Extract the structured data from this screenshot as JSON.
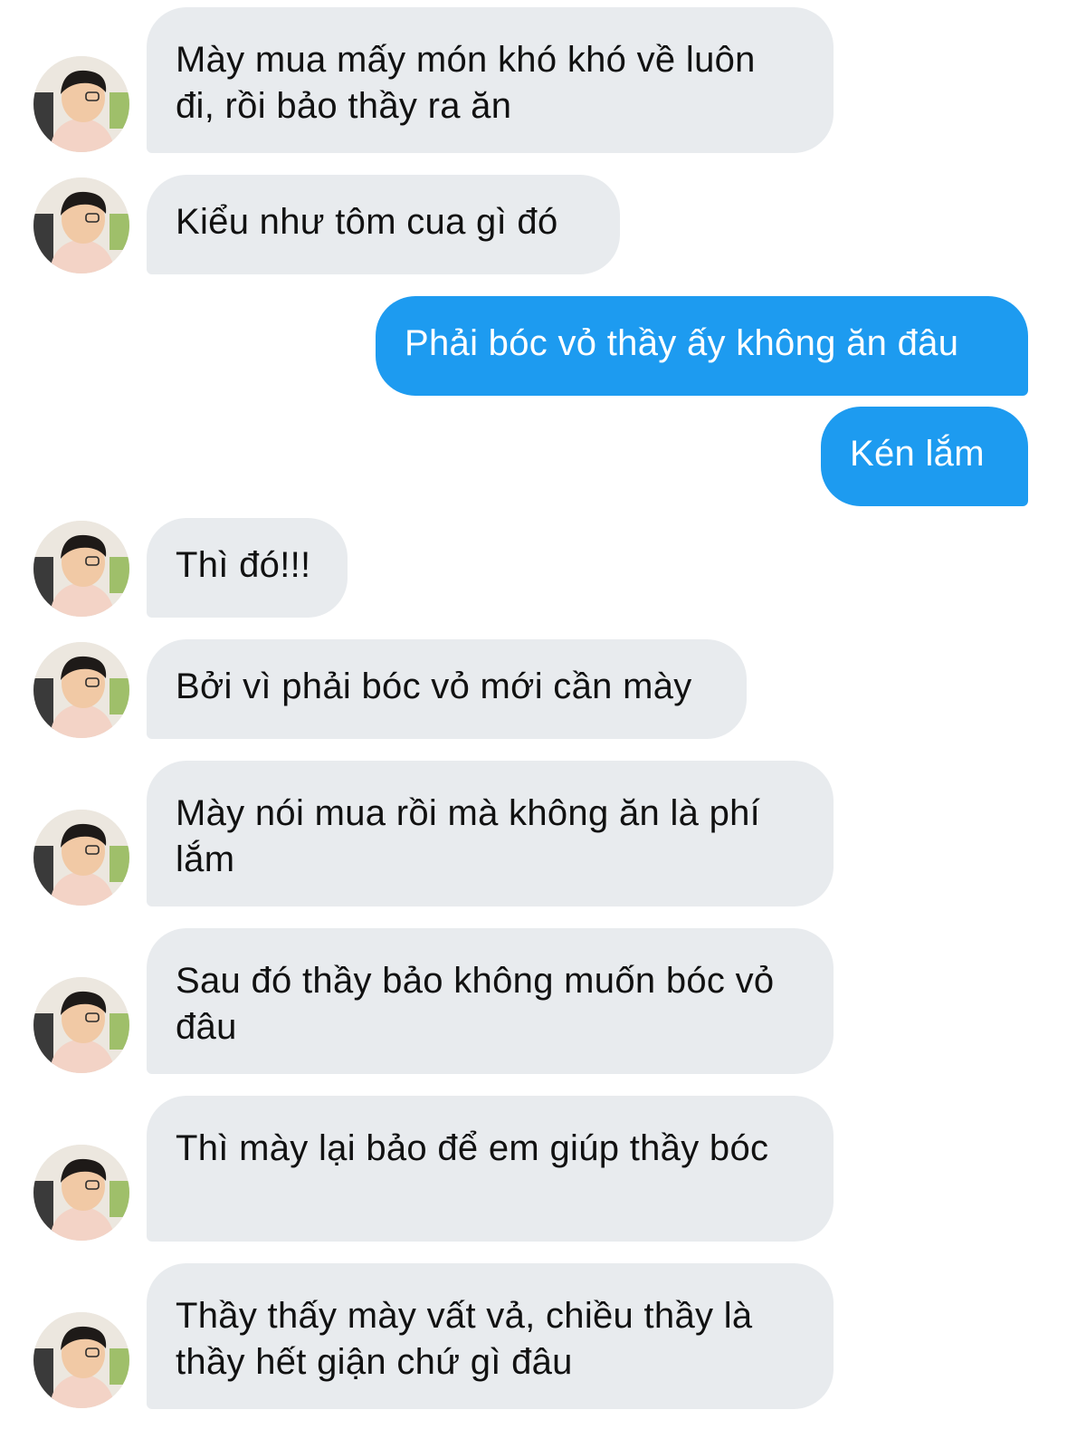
{
  "conversation": {
    "messages": [
      {
        "direction": "in",
        "text": "Mày mua mấy món khó khó về luôn đi, rồi bảo thầy ra ăn"
      },
      {
        "direction": "in",
        "text": "Kiểu như tôm cua gì đó"
      },
      {
        "direction": "out",
        "text": "Phải bóc vỏ thầy ấy không ăn đâu"
      },
      {
        "direction": "out",
        "text": "Kén lắm"
      },
      {
        "direction": "in",
        "text": "Thì đó!!!"
      },
      {
        "direction": "in",
        "text": "Bởi vì phải bóc vỏ mới cần mày"
      },
      {
        "direction": "in",
        "text": "Mày nói mua rồi mà không ăn là phí lắm"
      },
      {
        "direction": "in",
        "text": "Sau đó thầy bảo không muốn bóc vỏ đâu"
      },
      {
        "direction": "in",
        "text": "Thì mày lại bảo để em giúp thầy bóc"
      },
      {
        "direction": "in",
        "text": "Thầy thấy mày vất vả, chiều thầy là thầy hết giận chứ gì đâu"
      }
    ]
  },
  "colors": {
    "incoming_bubble": "#e8ebee",
    "outgoing_bubble": "#1d9bf0",
    "incoming_text": "#111111",
    "outgoing_text": "#ffffff"
  },
  "icons": {
    "avatar": "user-photo-avatar"
  }
}
